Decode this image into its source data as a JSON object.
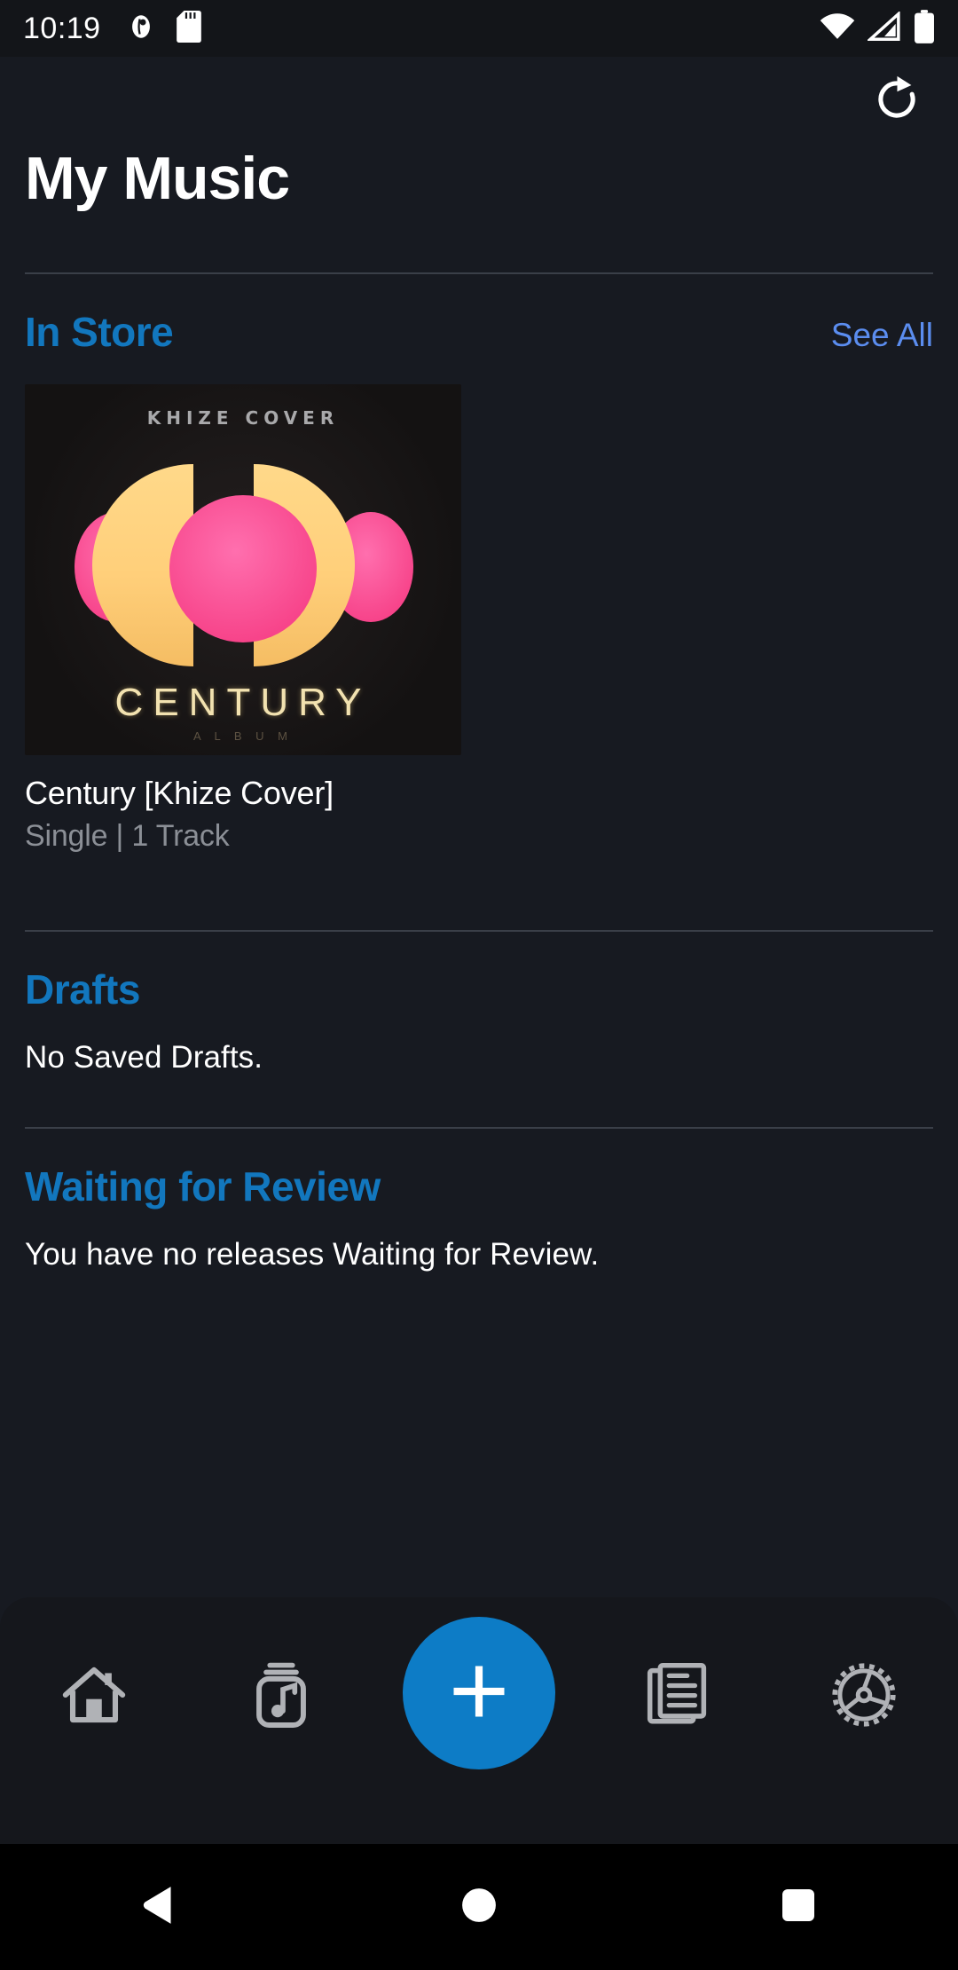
{
  "status_bar": {
    "time": "10:19",
    "left_icons": [
      "notification-icon",
      "sd-card-icon"
    ],
    "right_icons": [
      "wifi-icon",
      "cellular-signal-icon",
      "battery-icon"
    ]
  },
  "header": {
    "title": "My Music",
    "refresh_icon": "refresh-icon"
  },
  "sections": {
    "in_store": {
      "title": "In Store",
      "see_all_label": "See All",
      "album": {
        "title": "Century [Khize Cover]",
        "meta": "Single | 1 Track",
        "art_top_text": "KHIZE COVER",
        "art_bottom_text": "CENTURY",
        "art_sub_text": "A L B U M"
      }
    },
    "drafts": {
      "title": "Drafts",
      "empty_text": "No Saved Drafts."
    },
    "waiting_for_review": {
      "title": "Waiting for Review",
      "empty_text": "You have no releases Waiting for Review."
    }
  },
  "bottom_nav": {
    "items": [
      {
        "name": "home-icon",
        "label": "Home"
      },
      {
        "name": "music-library-icon",
        "label": "Music"
      },
      {
        "name": "add-icon",
        "label": "Add"
      },
      {
        "name": "releases-document-icon",
        "label": "Releases"
      },
      {
        "name": "settings-gear-icon",
        "label": "Settings"
      }
    ]
  },
  "android_nav": {
    "back": "back-triangle-icon",
    "home": "home-circle-icon",
    "recents": "recents-square-icon"
  },
  "colors": {
    "background": "#171a21",
    "nav_background": "#15171c",
    "heading_blue": "#1277be",
    "link_blue": "#5b8def",
    "accent_blue": "#0d7cc6",
    "text_primary": "#ffffff",
    "text_secondary": "#8b8f96",
    "divider": "#3a3f48"
  }
}
